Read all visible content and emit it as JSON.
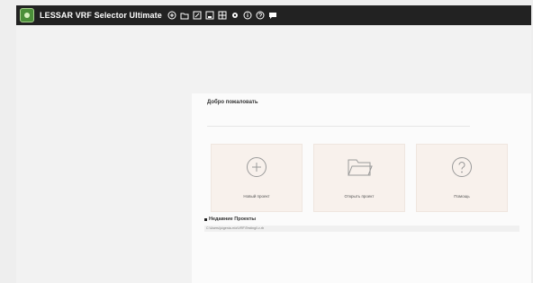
{
  "window": {
    "title": "LESSAR VRF Selector Ultimate",
    "toolbar_icons": [
      "add-circle-icon",
      "open-folder-icon",
      "edit-icon",
      "save-icon",
      "grid-icon",
      "settings-icon",
      "info-icon",
      "help-icon",
      "chat-icon"
    ]
  },
  "welcome": {
    "title": "Добро пожаловать",
    "tiles": [
      {
        "label": "Новый проект",
        "icon": "plus-circle-icon"
      },
      {
        "label": "Открыть проект",
        "icon": "folder-icon"
      },
      {
        "label": "Помощь",
        "icon": "help-circle-icon"
      }
    ],
    "recent": {
      "title": "Недавние Проекты",
      "items": [
        "C:\\Users\\ju\\genia-m\\c\\VRF\\Testing\\l.v-rb"
      ]
    }
  },
  "colors": {
    "titlebar": "#222222",
    "tile_bg": "#f8f1ec",
    "icon_stroke": "#9a9a9a"
  }
}
